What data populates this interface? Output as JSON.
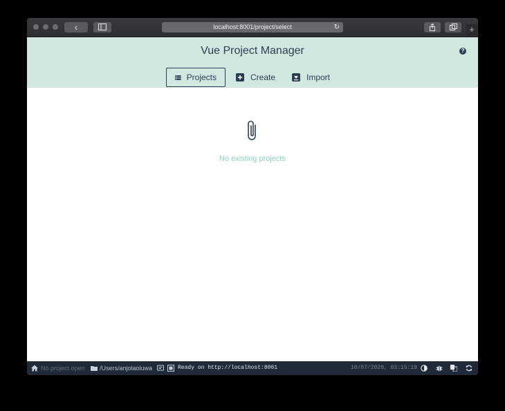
{
  "browser": {
    "url": "localhost:8001/project/select",
    "back_glyph": "‹",
    "reload_glyph": "↻",
    "new_tab_glyph": "+"
  },
  "header": {
    "title": "Vue Project Manager",
    "help_glyph": "?",
    "tabs": [
      {
        "label": "Projects",
        "icon": "list-icon",
        "selected": true
      },
      {
        "label": "Create",
        "icon": "plus-icon",
        "selected": false
      },
      {
        "label": "Import",
        "icon": "import-icon",
        "selected": false
      }
    ]
  },
  "main": {
    "empty_icon": "paperclip-icon",
    "empty_text": "No existing projects"
  },
  "statusbar": {
    "project": "No project open",
    "cwd": "/Users/anjolaoluwa",
    "log": "Ready on http://localhost:8001",
    "timestamp": "10/07/2020, 03:15:19"
  },
  "colors": {
    "header_bg": "#d0e8df",
    "text_dark": "#2c3e50",
    "accent_green": "#8bd0ba",
    "statusbar_bg": "#1f2a36"
  }
}
